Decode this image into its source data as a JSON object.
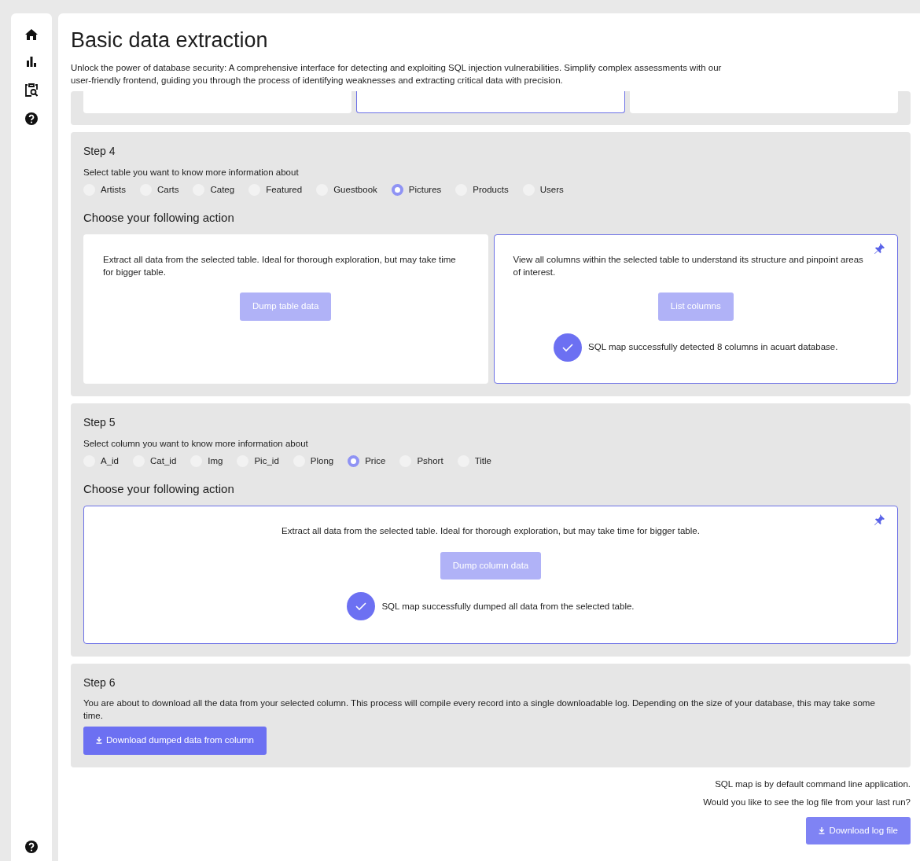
{
  "page": {
    "title": "Basic data extraction",
    "description": "Unlock the power of database security: A comprehensive interface for detecting and exploiting SQL injection vulnerabilities. Simplify complex assessments with our user-friendly frontend, guiding you through the process of identifying weaknesses and extracting critical data with precision."
  },
  "previous_step": {
    "cards": [
      {
        "selected": false
      },
      {
        "selected": true
      },
      {
        "selected": false
      }
    ]
  },
  "steps": [
    {
      "kind": "select",
      "title": "Step 4",
      "prompt": "Select table you want to know more information about",
      "options": [
        {
          "label": "Artists",
          "selected": false
        },
        {
          "label": "Carts",
          "selected": false
        },
        {
          "label": "Categ",
          "selected": false
        },
        {
          "label": "Featured",
          "selected": false
        },
        {
          "label": "Guestbook",
          "selected": false
        },
        {
          "label": "Pictures",
          "selected": true
        },
        {
          "label": "Products",
          "selected": false
        },
        {
          "label": "Users",
          "selected": false
        }
      ],
      "action_heading": "Choose your following action",
      "actions": [
        {
          "description": "Extract all data from the selected table. Ideal for thorough exploration, but may take time for bigger table.",
          "button": "Dump table data",
          "disabled": true,
          "selected": false
        },
        {
          "description": "View all columns within the selected table to understand its structure and pinpoint areas of interest.",
          "button": "List columns",
          "disabled": true,
          "selected": true,
          "result": "SQL map successfully detected 8 columns in acuart database."
        }
      ]
    },
    {
      "kind": "select",
      "title": "Step 5",
      "prompt": "Select column you want to know more information about",
      "options": [
        {
          "label": "A_id",
          "selected": false
        },
        {
          "label": "Cat_id",
          "selected": false
        },
        {
          "label": "Img",
          "selected": false
        },
        {
          "label": "Pic_id",
          "selected": false
        },
        {
          "label": "Plong",
          "selected": false
        },
        {
          "label": "Price",
          "selected": true
        },
        {
          "label": "Pshort",
          "selected": false
        },
        {
          "label": "Title",
          "selected": false
        }
      ],
      "action_heading": "Choose your following action",
      "actions": [
        {
          "description": "Extract all data from the selected table. Ideal for thorough exploration, but may take time for bigger table.",
          "button": "Dump column data",
          "disabled": true,
          "selected": true,
          "result": "SQL map successfully dumped all data from the selected table."
        }
      ]
    },
    {
      "kind": "download",
      "title": "Step 6",
      "text": "You are about to download all the data from your selected column. This process will compile every record into a single downloadable log. Depending on the size of your database, this may take some time.",
      "button": "Download dumped data from column",
      "disabled": false
    }
  ],
  "footer": {
    "lines": [
      "SQL map is by default command line application.",
      "Would you like to see the log file from your last run?"
    ],
    "button": "Download log file"
  }
}
